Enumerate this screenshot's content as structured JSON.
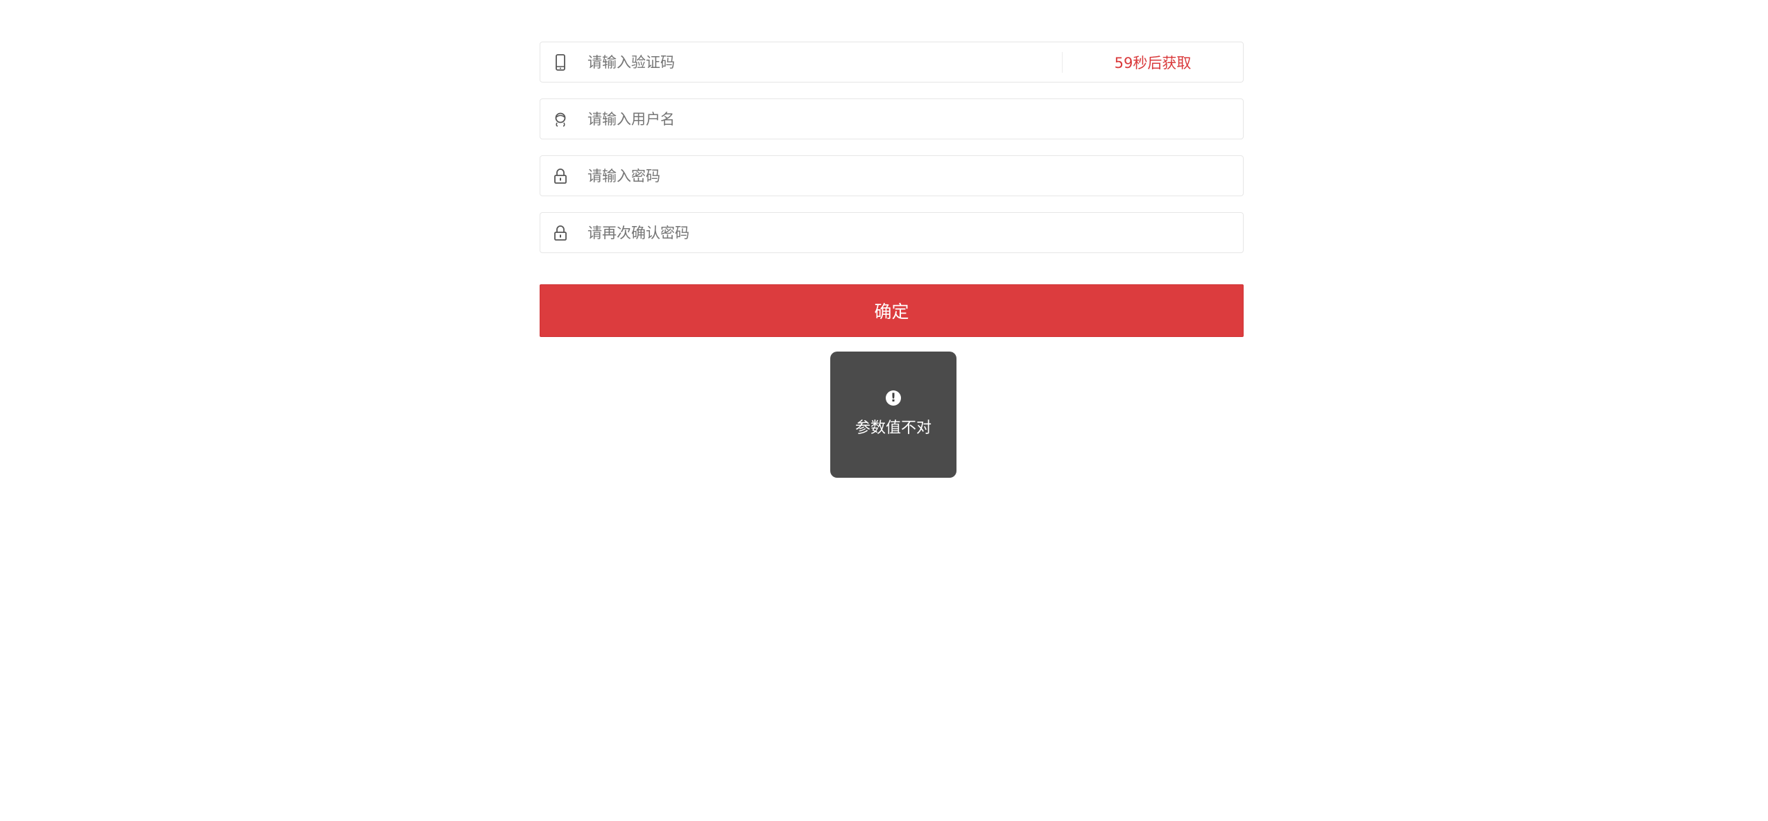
{
  "form": {
    "code": {
      "placeholder": "请输入验证码",
      "icon": "phone-icon",
      "send_label": "59秒后获取"
    },
    "username": {
      "placeholder": "请输入用户名",
      "icon": "user-icon"
    },
    "password": {
      "placeholder": "请输入密码",
      "icon": "lock-icon"
    },
    "confirm_password": {
      "placeholder": "请再次确认密码",
      "icon": "lock-icon"
    },
    "submit_label": "确定"
  },
  "toast": {
    "icon": "exclamation-icon",
    "message": "参数值不对"
  },
  "colors": {
    "accent": "#dc3c3e",
    "toast_bg": "#3c3c3c",
    "border": "#e6e6e6"
  }
}
